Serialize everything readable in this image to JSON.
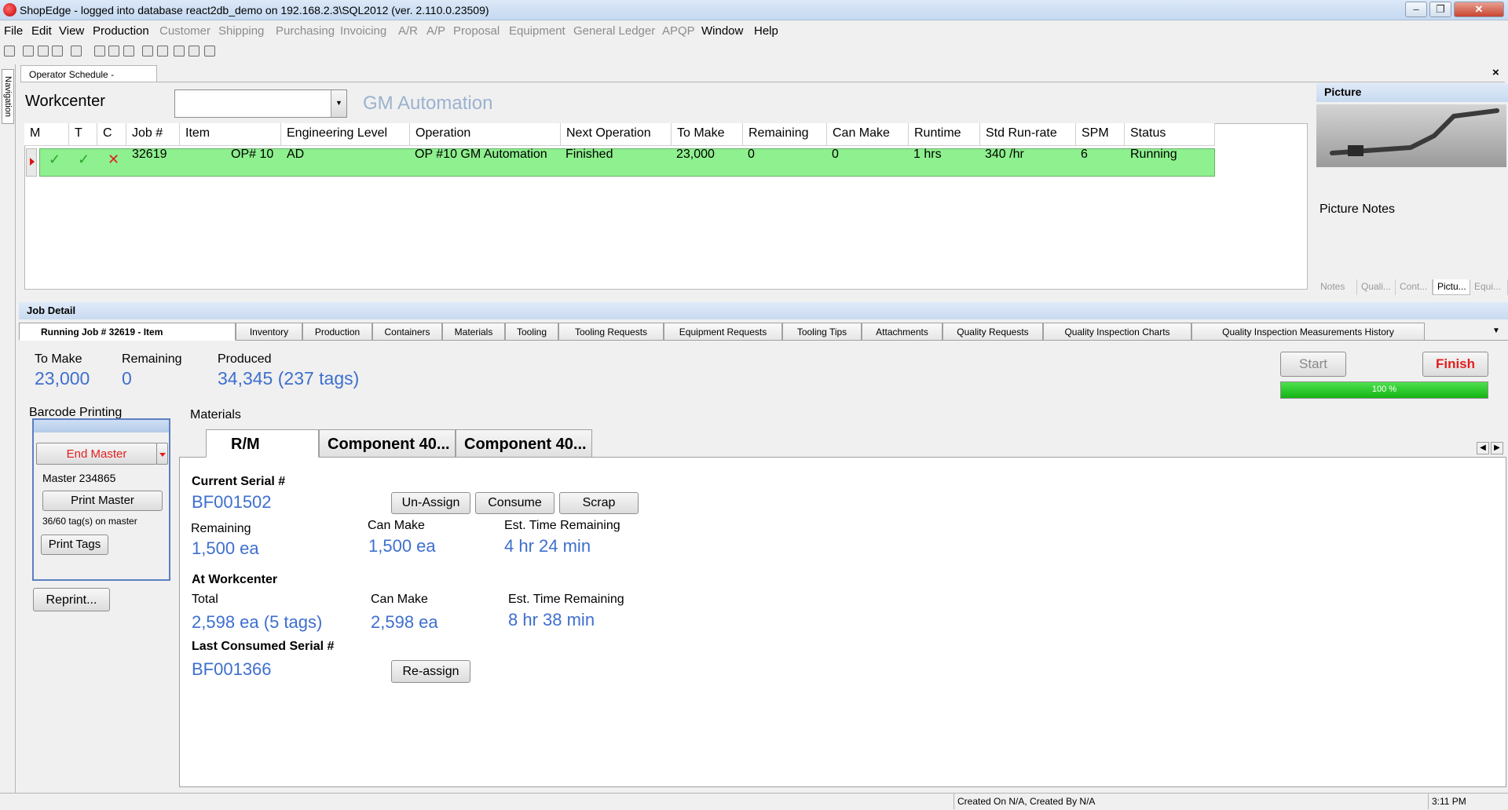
{
  "window": {
    "title": "ShopEdge - logged into database react2db_demo on 192.168.2.3\\SQL2012 (ver. 2.110.0.23509)",
    "min_glyph": "–",
    "max_glyph": "❐",
    "close_glyph": "✕"
  },
  "menu": {
    "items": [
      {
        "label": "File",
        "dim": false
      },
      {
        "label": "Edit",
        "dim": false
      },
      {
        "label": "View",
        "dim": false
      },
      {
        "label": "Production",
        "dim": false
      },
      {
        "label": "Customer",
        "dim": true
      },
      {
        "label": "Shipping",
        "dim": true
      },
      {
        "label": "Purchasing",
        "dim": true
      },
      {
        "label": "Invoicing",
        "dim": true
      },
      {
        "label": "A/R",
        "dim": true
      },
      {
        "label": "A/P",
        "dim": true
      },
      {
        "label": "Proposal",
        "dim": true
      },
      {
        "label": "Equipment",
        "dim": true
      },
      {
        "label": "General Ledger",
        "dim": true
      },
      {
        "label": "APQP",
        "dim": true
      },
      {
        "label": "Window",
        "dim": false
      },
      {
        "label": "Help",
        "dim": false
      }
    ]
  },
  "nav": {
    "label": "Navigation"
  },
  "document_tab": {
    "label": "Operator Schedule -",
    "close": "×"
  },
  "workcenter": {
    "label": "Workcenter",
    "combo_value": "",
    "name": "GM Automation",
    "dropdown_glyph": "▼"
  },
  "grid": {
    "columns": [
      "M",
      "T",
      "C",
      "Job #",
      "Item",
      "Engineering Level",
      "Operation",
      "Next Operation",
      "To Make",
      "Remaining",
      "Can Make",
      "Runtime",
      "Std Run-rate",
      "SPM",
      "Status"
    ],
    "row": {
      "m": "✓",
      "t": "✓",
      "c": "✕",
      "job": "32619",
      "item": "OP# 10",
      "eng_level": "AD",
      "operation": "OP #10 GM Automation",
      "next_operation": "Finished",
      "to_make": "23,000",
      "remaining": "0",
      "can_make": "0",
      "runtime": "1 hrs",
      "std_run_rate": "340 /hr",
      "spm": "6",
      "status": "Running"
    }
  },
  "picture_panel": {
    "header": "Picture",
    "notes_label": "Picture Notes",
    "tabs": [
      {
        "label": "Notes",
        "active": false
      },
      {
        "label": "Quali...",
        "active": false
      },
      {
        "label": "Cont...",
        "active": false
      },
      {
        "label": "Pictu...",
        "active": true
      },
      {
        "label": "Equi...",
        "active": false
      }
    ]
  },
  "job_detail": {
    "header": "Job Detail",
    "tabs": [
      "Running Job # 32619 - Item",
      "Inventory",
      "Production",
      "Containers",
      "Materials",
      "Tooling",
      "Tooling Requests",
      "Equipment Requests",
      "Tooling Tips",
      "Attachments",
      "Quality Requests",
      "Quality Inspection Charts",
      "Quality Inspection Measurements History"
    ],
    "overflow_glyph": "▼",
    "to_make_label": "To Make",
    "to_make": "23,000",
    "remaining_label": "Remaining",
    "remaining": "0",
    "produced_label": "Produced",
    "produced": "34,345 (237 tags)",
    "start_label": "Start",
    "finish_label": "Finish",
    "progress_percent": 100,
    "progress_text": "100 %"
  },
  "barcode": {
    "title": "Barcode Printing",
    "end_master_label": "End Master",
    "master_text": "Master 234865",
    "print_master_label": "Print Master",
    "tags_on_master": "36/60 tag(s) on master",
    "print_tags_label": "Print Tags",
    "reprint_label": "Reprint..."
  },
  "materials": {
    "title": "Materials",
    "tabs": [
      {
        "label": "R/M",
        "active": true
      },
      {
        "label": "Component 40...",
        "active": false
      },
      {
        "label": "Component 40...",
        "active": false
      }
    ],
    "scroll_left": "◀",
    "scroll_right": "▶",
    "current_serial_label": "Current Serial #",
    "current_serial": "BF001502",
    "unassign_label": "Un-Assign",
    "consume_label": "Consume",
    "scrap_label": "Scrap",
    "remaining_label": "Remaining",
    "remaining": "1,500 ea",
    "can_make_label": "Can Make",
    "can_make": "1,500 ea",
    "est_time_label": "Est. Time Remaining",
    "est_time": "4 hr 24 min",
    "at_workcenter_label": "At Workcenter",
    "total_label": "Total",
    "total": "2,598 ea (5 tags)",
    "wc_can_make_label": "Can Make",
    "wc_can_make": "2,598 ea",
    "wc_est_time_label": "Est. Time Remaining",
    "wc_est_time": "8 hr 38 min",
    "last_consumed_label": "Last Consumed Serial #",
    "last_consumed": "BF001366",
    "reassign_label": "Re-assign"
  },
  "statusbar": {
    "created": "Created On N/A, Created By N/A",
    "time": "3:11 PM"
  }
}
